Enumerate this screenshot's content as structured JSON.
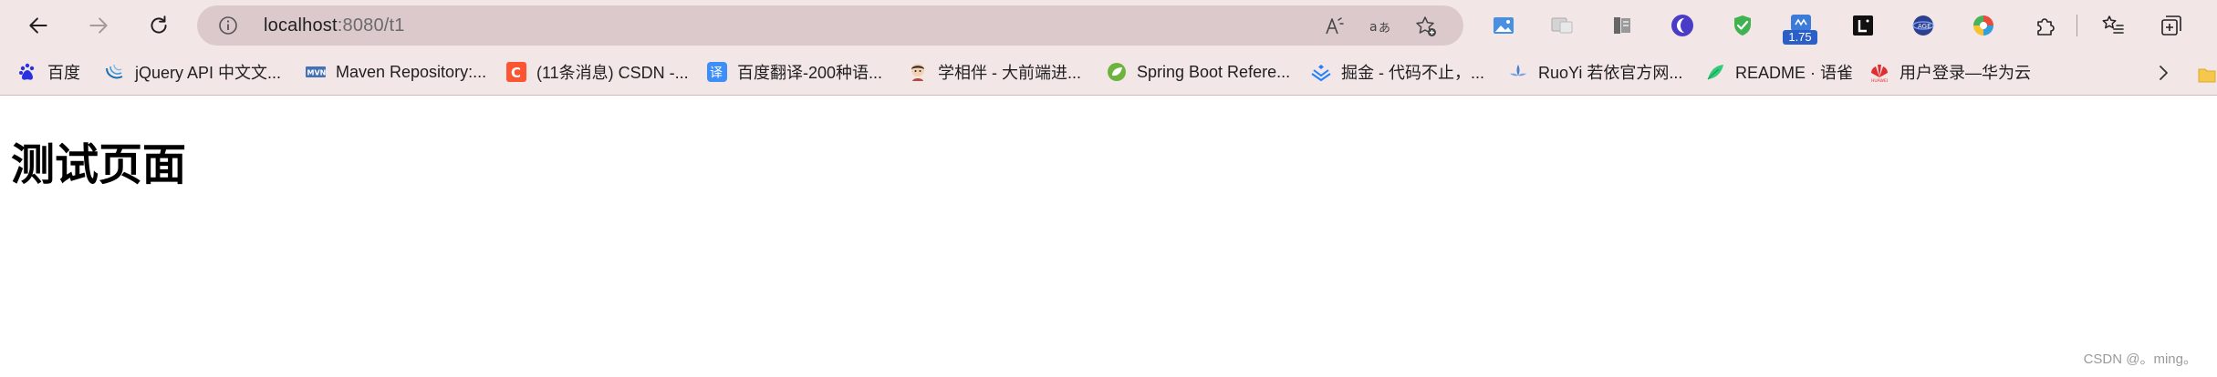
{
  "toolbar": {
    "back_icon": "back-arrow-icon",
    "forward_icon": "forward-arrow-icon",
    "refresh_icon": "refresh-icon",
    "address": {
      "host": "localhost",
      "port_path": ":8080/t1",
      "info_icon": "info-icon",
      "read_aloud_icon": "read-aloud-icon",
      "translate_icon": "translate-icon",
      "favorite_icon": "add-favorite-icon"
    },
    "extensions": [
      {
        "name": "image-extension-icon"
      },
      {
        "name": "reader-extension-icon"
      },
      {
        "name": "collections-book-icon"
      },
      {
        "name": "moon-extension-icon"
      },
      {
        "name": "shield-check-extension-icon"
      },
      {
        "name": "speed-extension-icon"
      },
      {
        "name": "l-extension-icon"
      },
      {
        "name": "globe-extension-icon"
      },
      {
        "name": "colorful-circle-extension-icon"
      },
      {
        "name": "puzzle-extensions-icon"
      },
      {
        "name": "favorites-list-icon"
      },
      {
        "name": "collections-icon"
      }
    ],
    "badge_value": "1.75"
  },
  "bookmarks": [
    {
      "label": "百度",
      "icon": "baidu-paw-icon"
    },
    {
      "label": "jQuery API 中文文...",
      "icon": "jquery-icon"
    },
    {
      "label": "Maven Repository:...",
      "icon": "maven-icon"
    },
    {
      "label": "(11条消息) CSDN -...",
      "icon": "csdn-icon"
    },
    {
      "label": "百度翻译-200种语...",
      "icon": "baidu-translate-icon"
    },
    {
      "label": "学相伴 - 大前端进...",
      "icon": "avatar-icon"
    },
    {
      "label": "Spring Boot Refere...",
      "icon": "spring-leaf-icon"
    },
    {
      "label": "掘金 - 代码不止，...",
      "icon": "juejin-icon"
    },
    {
      "label": "RuoYi 若依官方网...",
      "icon": "ruoyi-icon"
    },
    {
      "label": "README · 语雀",
      "icon": "yuque-icon"
    },
    {
      "label": "用户登录—华为云",
      "icon": "huawei-icon"
    }
  ],
  "page": {
    "title": "测试页面",
    "watermark": "CSDN @。ming。"
  },
  "colors": {
    "chrome_bg": "#f3e6e7",
    "address_bg": "#dcc9cb",
    "page_bg": "#ffffff"
  }
}
